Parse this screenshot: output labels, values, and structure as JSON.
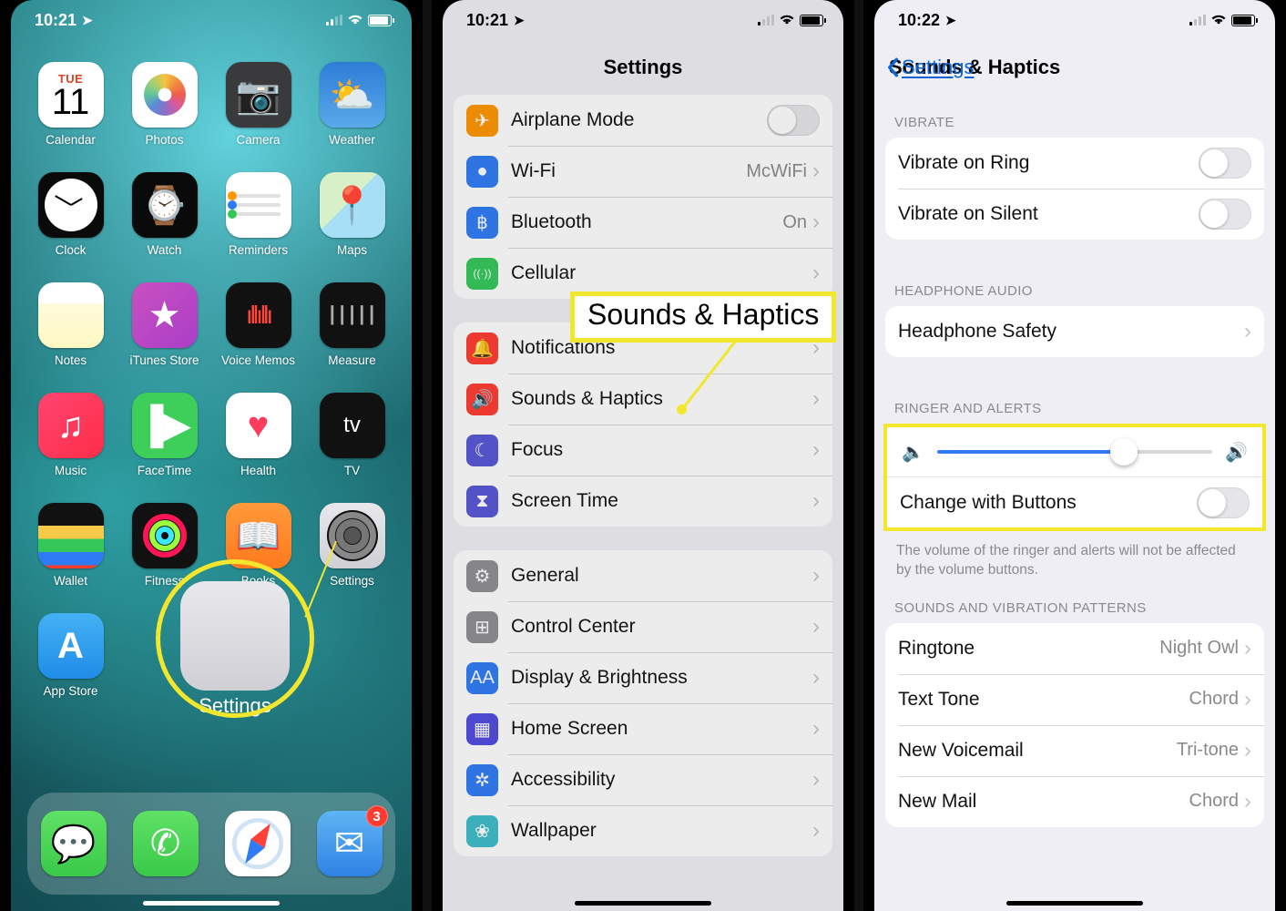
{
  "panel1": {
    "time": "10:21",
    "calendar": {
      "dow": "TUE",
      "dom": "11"
    },
    "apps_row1": [
      "Calendar",
      "Photos",
      "Camera",
      "Weather"
    ],
    "apps_row2": [
      "Clock",
      "Watch",
      "Reminders",
      "Maps"
    ],
    "apps_row3": [
      "Notes",
      "iTunes Store",
      "Voice Memos",
      "Measure"
    ],
    "apps_row4": [
      "Music",
      "FaceTime",
      "Health",
      "TV"
    ],
    "apps_row5": [
      "Wallet",
      "Fitness",
      "Books",
      "Settings"
    ],
    "apps_row6": [
      "App Store"
    ],
    "dock_apps": [
      "Messages",
      "Phone",
      "Safari",
      "Mail"
    ],
    "mail_badge": "3",
    "zoom_label": "Settings"
  },
  "panel2": {
    "time": "10:21",
    "nav_title": "Settings",
    "callout": "Sounds & Haptics",
    "group1": [
      {
        "icon": "ic-air",
        "glyph": "✈",
        "title": "Airplane Mode",
        "trailing": "toggle"
      },
      {
        "icon": "ic-wifi",
        "glyph": "●",
        "title": "Wi-Fi",
        "value": "McWiFi",
        "trailing": "chev"
      },
      {
        "icon": "ic-bt",
        "glyph": "฿",
        "title": "Bluetooth",
        "value": "On",
        "trailing": "chev"
      },
      {
        "icon": "ic-cell",
        "glyph": "((·))",
        "title": "Cellular",
        "trailing": "chev"
      }
    ],
    "group2": [
      {
        "icon": "ic-notif",
        "glyph": "🔔",
        "title": "Notifications",
        "trailing": "chev"
      },
      {
        "icon": "ic-sounds",
        "glyph": "🔊",
        "title": "Sounds & Haptics",
        "trailing": "chev",
        "pointer": true
      },
      {
        "icon": "ic-focus",
        "glyph": "☾",
        "title": "Focus",
        "trailing": "chev"
      },
      {
        "icon": "ic-screentime",
        "glyph": "⧗",
        "title": "Screen Time",
        "trailing": "chev"
      }
    ],
    "group3": [
      {
        "icon": "ic-general",
        "glyph": "⚙",
        "title": "General",
        "trailing": "chev"
      },
      {
        "icon": "ic-cc",
        "glyph": "⊞",
        "title": "Control Center",
        "trailing": "chev"
      },
      {
        "icon": "ic-display",
        "glyph": "AA",
        "title": "Display & Brightness",
        "trailing": "chev"
      },
      {
        "icon": "ic-home",
        "glyph": "▦",
        "title": "Home Screen",
        "trailing": "chev"
      },
      {
        "icon": "ic-access",
        "glyph": "✲",
        "title": "Accessibility",
        "trailing": "chev"
      },
      {
        "icon": "ic-wallpaper",
        "glyph": "❀",
        "title": "Wallpaper",
        "trailing": "chev"
      }
    ]
  },
  "panel3": {
    "time": "10:22",
    "back_label": "Settings",
    "nav_title": "Sounds & Haptics",
    "sec_vibrate": "VIBRATE",
    "vibrate_rows": [
      {
        "title": "Vibrate on Ring",
        "trailing": "toggle"
      },
      {
        "title": "Vibrate on Silent",
        "trailing": "toggle"
      }
    ],
    "sec_headphone": "HEADPHONE AUDIO",
    "headphone_rows": [
      {
        "title": "Headphone Safety",
        "trailing": "chev"
      }
    ],
    "sec_ringer": "RINGER AND ALERTS",
    "slider_value_pct": 68,
    "change_buttons_label": "Change with Buttons",
    "ringer_footer": "The volume of the ringer and alerts will not be affected by the volume buttons.",
    "sec_patterns": "SOUNDS AND VIBRATION PATTERNS",
    "pattern_rows": [
      {
        "title": "Ringtone",
        "value": "Night Owl"
      },
      {
        "title": "Text Tone",
        "value": "Chord"
      },
      {
        "title": "New Voicemail",
        "value": "Tri-tone"
      },
      {
        "title": "New Mail",
        "value": "Chord"
      }
    ]
  }
}
